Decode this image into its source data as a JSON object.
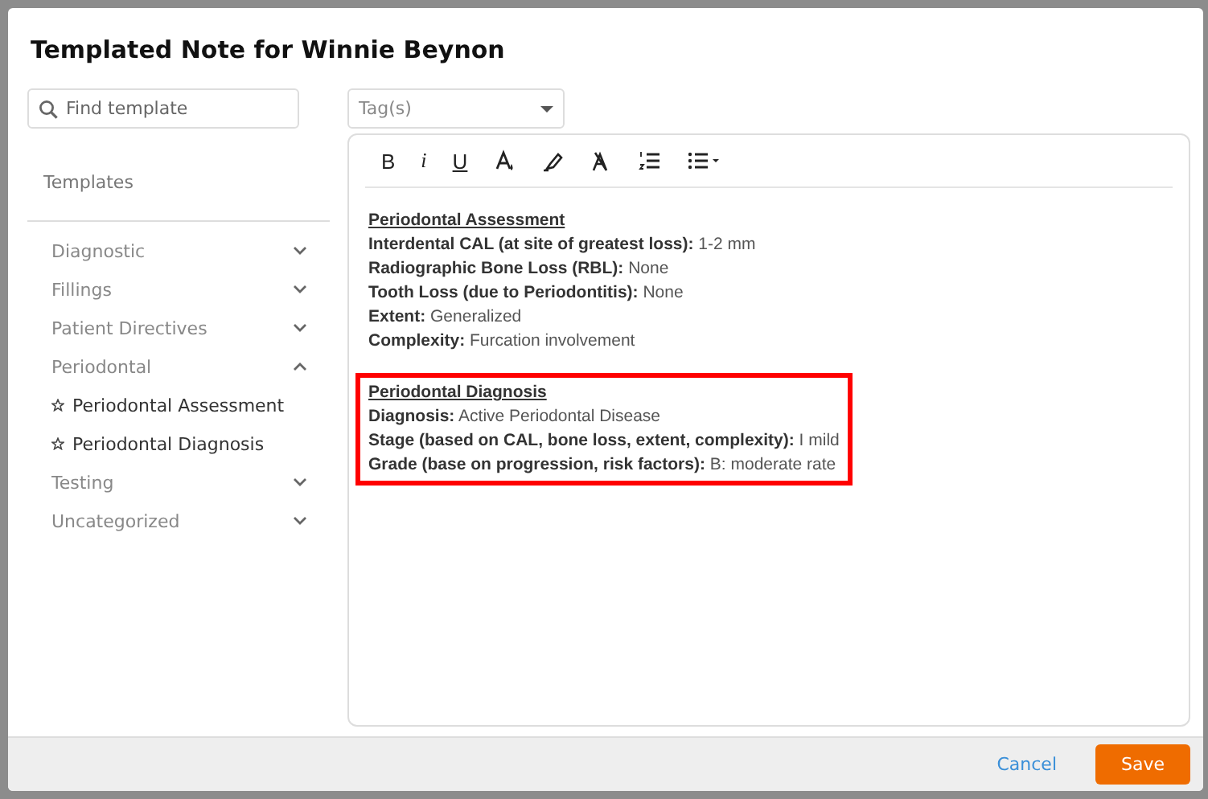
{
  "window": {
    "title": "Templated Note for Winnie Beynon"
  },
  "search": {
    "placeholder": "Find template"
  },
  "tags": {
    "placeholder": "Tag(s)"
  },
  "templates_heading": "Templates",
  "categories": [
    {
      "label": "Diagnostic",
      "expanded": false
    },
    {
      "label": "Fillings",
      "expanded": false
    },
    {
      "label": "Patient Directives",
      "expanded": false
    },
    {
      "label": "Periodontal",
      "expanded": true,
      "children": [
        {
          "label": "Periodontal Assessment"
        },
        {
          "label": "Periodontal Diagnosis"
        }
      ]
    },
    {
      "label": "Testing",
      "expanded": false
    },
    {
      "label": "Uncategorized",
      "expanded": false
    }
  ],
  "toolbar": [
    {
      "kind": "bold",
      "label": "B"
    },
    {
      "kind": "italic",
      "label": "i"
    },
    {
      "kind": "underline",
      "label": "U"
    },
    {
      "kind": "font-color"
    },
    {
      "kind": "highlight"
    },
    {
      "kind": "clear-format"
    },
    {
      "kind": "ordered-list"
    },
    {
      "kind": "bullet-list"
    }
  ],
  "sections": [
    {
      "heading": "Periodontal Assessment",
      "highlighted": false,
      "lines": [
        {
          "label": "Interdental CAL (at site of greatest loss):",
          "value": "1-2 mm"
        },
        {
          "label": "Radiographic Bone Loss (RBL):",
          "value": "None"
        },
        {
          "label": "Tooth Loss (due to Periodontitis):",
          "value": "None"
        },
        {
          "label": "Extent:",
          "value": "Generalized"
        },
        {
          "label": "Complexity:",
          "value": "Furcation involvement"
        }
      ]
    },
    {
      "heading": "Periodontal Diagnosis",
      "highlighted": true,
      "lines": [
        {
          "label": "Diagnosis:",
          "value": "Active Periodontal Disease"
        },
        {
          "label": "Stage (based on CAL, bone loss, extent, complexity):",
          "value": "I mild"
        },
        {
          "label": "Grade (base on progression, risk factors):",
          "value": "B: moderate rate"
        }
      ]
    }
  ],
  "footer": {
    "cancel": "Cancel",
    "save": "Save"
  }
}
